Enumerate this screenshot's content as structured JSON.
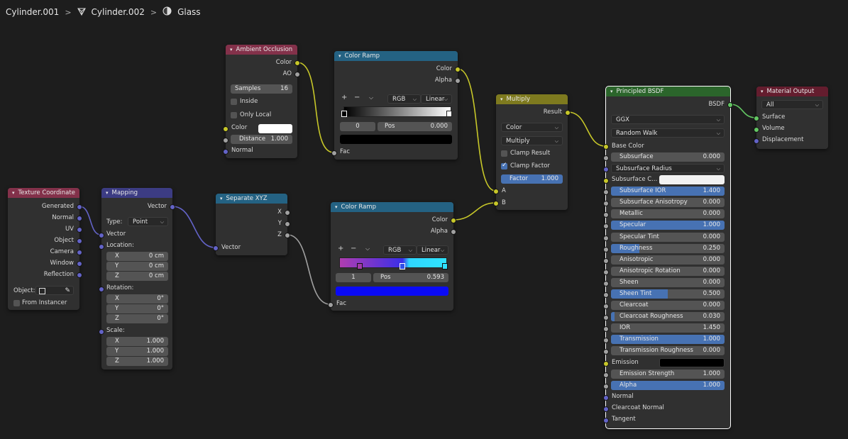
{
  "breadcrumb": {
    "items": [
      "Cylinder.001",
      "Cylinder.002",
      "Glass"
    ],
    "separator": ">"
  },
  "icons": {
    "mesh_object": "mesh-icon",
    "material": "material-sphere-icon",
    "collapse": "chevron-down-icon",
    "eyedropper": "eyedropper-icon"
  },
  "colors": {
    "canvas": "#1d1d1d",
    "node_body": "#303030",
    "field": "#545454",
    "field_active": "#4772b3",
    "socket_color": "#c7c729",
    "socket_float": "#a1a1a1",
    "socket_vector": "#6363c7",
    "socket_shader": "#63c763"
  },
  "nodes": {
    "ambient_occlusion": {
      "title": "Ambient Occlusion",
      "outputs": [
        "Color",
        "AO"
      ],
      "samples_label": "Samples",
      "samples_value": "16",
      "inside_label": "Inside",
      "inside_checked": false,
      "only_local_label": "Only Local",
      "only_local_checked": false,
      "color_label": "Color",
      "color_value": "#ffffff",
      "distance_label": "Distance",
      "distance_value": "1.000",
      "normal_label": "Normal"
    },
    "color_ramp_1": {
      "title": "Color Ramp",
      "outputs": [
        "Color",
        "Alpha"
      ],
      "mode": "RGB",
      "interpolation": "Linear",
      "stop_index": "0",
      "pos_label": "Pos",
      "pos_value": "0.000",
      "stop_color": "#000000",
      "fac_label": "Fac"
    },
    "color_ramp_2": {
      "title": "Color Ramp",
      "outputs": [
        "Color",
        "Alpha"
      ],
      "mode": "RGB",
      "interpolation": "Linear",
      "stop_index": "1",
      "pos_label": "Pos",
      "pos_value": "0.593",
      "stop_color": "#0a0af5",
      "fac_label": "Fac"
    },
    "multiply": {
      "title": "Multiply",
      "output": "Result",
      "data_type": "Color",
      "blend": "Multiply",
      "clamp_result_label": "Clamp Result",
      "clamp_result_checked": false,
      "clamp_factor_label": "Clamp Factor",
      "clamp_factor_checked": true,
      "factor_label": "Factor",
      "factor_value": "1.000",
      "input_a": "A",
      "input_b": "B"
    },
    "texture_coordinate": {
      "title": "Texture Coordinate",
      "outputs": [
        "Generated",
        "Normal",
        "UV",
        "Object",
        "Camera",
        "Window",
        "Reflection"
      ],
      "object_label": "Object:",
      "from_instancer_label": "From Instancer",
      "from_instancer_checked": false
    },
    "mapping": {
      "title": "Mapping",
      "output": "Vector",
      "type_label": "Type:",
      "type_value": "Point",
      "vector_label": "Vector",
      "location_label": "Location:",
      "location": [
        {
          "axis": "X",
          "value": "0 cm"
        },
        {
          "axis": "Y",
          "value": "0 cm"
        },
        {
          "axis": "Z",
          "value": "0 cm"
        }
      ],
      "rotation_label": "Rotation:",
      "rotation": [
        {
          "axis": "X",
          "value": "0°"
        },
        {
          "axis": "Y",
          "value": "0°"
        },
        {
          "axis": "Z",
          "value": "0°"
        }
      ],
      "scale_label": "Scale:",
      "scale": [
        {
          "axis": "X",
          "value": "1.000"
        },
        {
          "axis": "Y",
          "value": "1.000"
        },
        {
          "axis": "Z",
          "value": "1.000"
        }
      ]
    },
    "separate_xyz": {
      "title": "Separate XYZ",
      "outputs": [
        "X",
        "Y",
        "Z"
      ],
      "input": "Vector"
    },
    "principled_bsdf": {
      "title": "Principled BSDF",
      "output": "BSDF",
      "distribution": "GGX",
      "subsurface_method": "Random Walk",
      "base_color_label": "Base Color",
      "subsurface_radius_label": "Subsurface Radius",
      "subsurface_color_label": "Subsurface C...",
      "subsurface_color_value": "#f2f2f2",
      "emission_label": "Emission",
      "emission_color_value": "#000000",
      "normal_label": "Normal",
      "clearcoat_normal_label": "Clearcoat Normal",
      "tangent_label": "Tangent",
      "params": [
        {
          "label": "Subsurface",
          "value": "0.000",
          "fraction": 0
        },
        {
          "label": "Subsurface IOR",
          "value": "1.400",
          "fraction": 1
        },
        {
          "label": "Subsurface Anisotropy",
          "value": "0.000",
          "fraction": 0
        },
        {
          "label": "Metallic",
          "value": "0.000",
          "fraction": 0
        },
        {
          "label": "Specular",
          "value": "1.000",
          "fraction": 1
        },
        {
          "label": "Specular Tint",
          "value": "0.000",
          "fraction": 0
        },
        {
          "label": "Roughness",
          "value": "0.250",
          "fraction": 0.25
        },
        {
          "label": "Anisotropic",
          "value": "0.000",
          "fraction": 0
        },
        {
          "label": "Anisotropic Rotation",
          "value": "0.000",
          "fraction": 0
        },
        {
          "label": "Sheen",
          "value": "0.000",
          "fraction": 0
        },
        {
          "label": "Sheen Tint",
          "value": "0.500",
          "fraction": 0.5
        },
        {
          "label": "Clearcoat",
          "value": "0.000",
          "fraction": 0
        },
        {
          "label": "Clearcoat Roughness",
          "value": "0.030",
          "fraction": 0.03
        },
        {
          "label": "IOR",
          "value": "1.450",
          "fraction": 0
        },
        {
          "label": "Transmission",
          "value": "1.000",
          "fraction": 1
        },
        {
          "label": "Transmission Roughness",
          "value": "0.000",
          "fraction": 0
        },
        {
          "label": "Emission Strength",
          "value": "1.000",
          "fraction": 0
        },
        {
          "label": "Alpha",
          "value": "1.000",
          "fraction": 1
        }
      ]
    },
    "material_output": {
      "title": "Material Output",
      "target": "All",
      "inputs": [
        "Surface",
        "Volume",
        "Displacement"
      ]
    }
  }
}
